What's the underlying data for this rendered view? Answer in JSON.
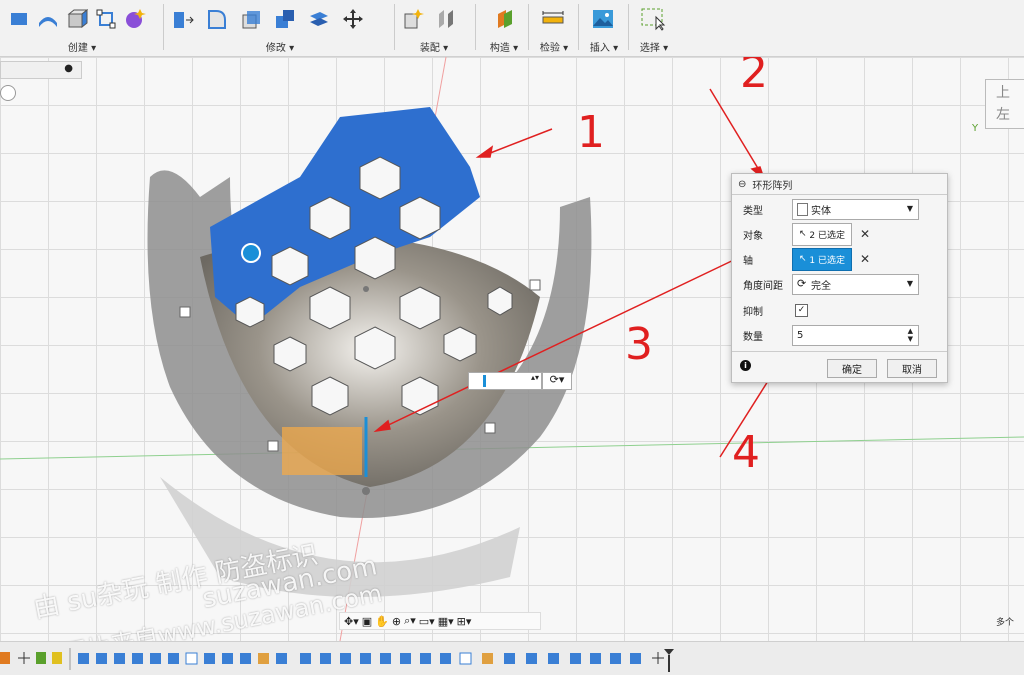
{
  "toolbar": {
    "groups": [
      {
        "label": "创建 ▾"
      },
      {
        "label": "修改 ▾"
      },
      {
        "label": "装配 ▾"
      },
      {
        "label": "构造 ▾"
      },
      {
        "label": "检验 ▾"
      },
      {
        "label": "插入 ▾"
      },
      {
        "label": "选择 ▾"
      }
    ]
  },
  "dialog": {
    "title": "环形阵列",
    "rows": {
      "type_label": "类型",
      "type_value": "实体",
      "object_label": "对象",
      "object_value": "2 已选定",
      "axis_label": "轴",
      "axis_value": "1 已选定",
      "spacing_label": "角度间距",
      "spacing_value": "完全",
      "suppress_label": "抑制",
      "count_label": "数量",
      "count_value": "5"
    },
    "ok": "确定",
    "cancel": "取消"
  },
  "annotations": [
    "1",
    "2",
    "3",
    "4"
  ],
  "viewcube": {
    "top": "上",
    "front": "左",
    "y_axis": "Y"
  },
  "watermark": {
    "line1": "由 su杂玩 制作 防盗标识",
    "line2": "suzawan.com",
    "line3": "图片来自www.suzawan.com"
  },
  "bottom_right_text": "多个",
  "colors": {
    "accent": "#1a8fd8",
    "selected_face": "#2e6fcf",
    "annotation": "#e02020"
  }
}
